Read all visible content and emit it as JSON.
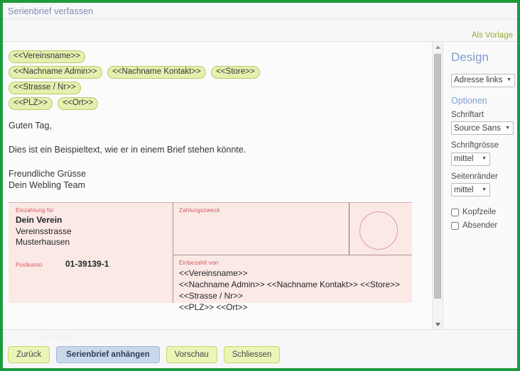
{
  "window": {
    "title": "Serienbrief verfassen",
    "border_color": "#1d9b3c"
  },
  "header": {
    "template_link": "Als Vorlage"
  },
  "editor": {
    "tag_lines": [
      [
        "<<Vereinsname>>"
      ],
      [
        "<<Nachname Admin>>",
        "<<Nachname Kontakt>>",
        "<<Store>>"
      ],
      [
        "<<Strasse / Nr>>"
      ],
      [
        "<<PLZ>>",
        "<<Ort>>"
      ]
    ],
    "greeting": "Guten Tag,",
    "paragraph": "Dies ist ein Beispieltext, wie er in einem Brief stehen könnte.",
    "closing_line1": "Freundliche Grüsse",
    "closing_line2": "Dein Webling Team"
  },
  "payment_slip": {
    "payee_label": "Einzahlung für",
    "payee_name": "Dein Verein",
    "payee_street": "Vereinsstrasse",
    "payee_city": "Musterhausen",
    "account_label": "Postkonto",
    "account_number": "01-39139-1",
    "purpose_label": "Zahlungszweck",
    "payer_label": "Einbezahlt von",
    "payer_lines": [
      "<<Vereinsname>>",
      "<<Nachname Admin>> <<Nachname Kontakt>> <<Store>>",
      "<<Strasse / Nr>>",
      "<<PLZ>> <<Ort>>"
    ]
  },
  "sidebar": {
    "heading": "Design",
    "layout_value": "Adresse links",
    "options_heading": "Optionen",
    "font_label": "Schriftart",
    "font_value": "Source Sans",
    "fontsize_label": "Schriftgrösse",
    "fontsize_value": "mittel",
    "margins_label": "Seitenränder",
    "margins_value": "mittel",
    "checkbox_header": "Kopfzeile",
    "checkbox_sender": "Absender"
  },
  "footer": {
    "ghost_text": "vorlagen",
    "btn_back": "Zurück",
    "btn_attach": "Serienbrief anhängen",
    "btn_preview": "Vorschau",
    "btn_close": "Schliessen"
  }
}
